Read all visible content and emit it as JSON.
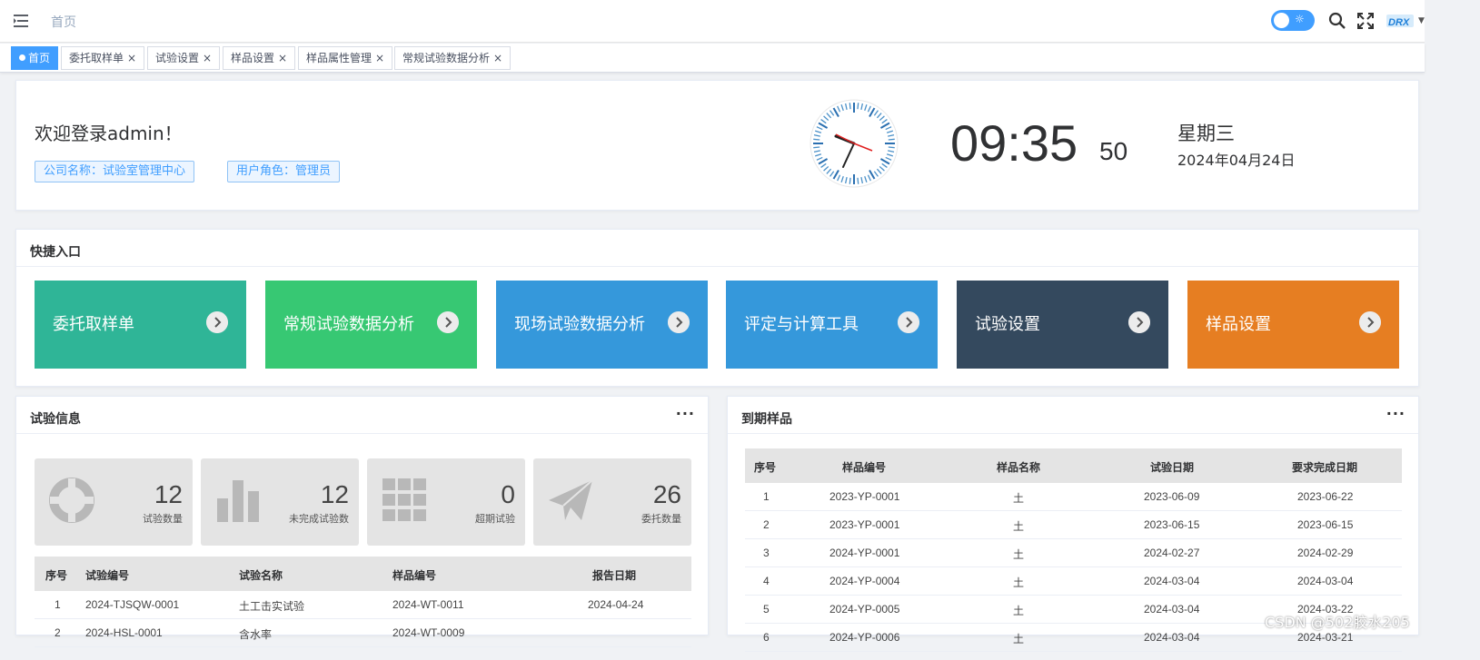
{
  "navbar": {
    "breadcrumb": "首页",
    "icons": [
      "hamburger-icon",
      "theme-toggle-sun-icon",
      "search-icon",
      "fullscreen-icon"
    ],
    "avatar_text": "DRX"
  },
  "tags": [
    {
      "label": "首页",
      "active": true
    },
    {
      "label": "委托取样单",
      "close": "×"
    },
    {
      "label": "试验设置",
      "close": "×"
    },
    {
      "label": "样品设置",
      "close": "×"
    },
    {
      "label": "样品属性管理",
      "close": "×"
    },
    {
      "label": "常规试验数据分析",
      "close": "×"
    }
  ],
  "welcome": {
    "title": "欢迎登录admin！",
    "company": "公司名称：试验室管理中心",
    "role": "用户角色：管理员",
    "time_hm": "09:35",
    "time_sec": "50",
    "weekday": "星期三",
    "date": "2024年04月24日"
  },
  "quick": {
    "title": "快捷入口",
    "tiles": [
      {
        "label": "委托取样单",
        "color": "#2fb597"
      },
      {
        "label": "常规试验数据分析",
        "color": "#37c873"
      },
      {
        "label": "现场试验数据分析",
        "color": "#3598db"
      },
      {
        "label": "评定与计算工具",
        "color": "#3598db"
      },
      {
        "label": "试验设置",
        "color": "#34495e"
      },
      {
        "label": "样品设置",
        "color": "#e67e22"
      }
    ]
  },
  "tests": {
    "title": "试验信息",
    "more": "···",
    "stats": [
      {
        "value": "12",
        "label": "试验数量",
        "icon": "lifebuoy-icon"
      },
      {
        "value": "12",
        "label": "未完成试验数",
        "icon": "bar-chart-icon"
      },
      {
        "value": "0",
        "label": "超期试验",
        "icon": "grid-icon"
      },
      {
        "value": "26",
        "label": "委托数量",
        "icon": "paper-plane-icon"
      }
    ],
    "columns": [
      "序号",
      "试验编号",
      "试验名称",
      "样品编号",
      "报告日期"
    ],
    "rows": [
      [
        "1",
        "2024-TJSQW-0001",
        "土工击实试验",
        "2024-WT-0011",
        "2024-04-24"
      ],
      [
        "2",
        "2024-HSL-0001",
        "含水率",
        "2024-WT-0009",
        ""
      ]
    ]
  },
  "expire": {
    "title": "到期样品",
    "more": "···",
    "columns": [
      "序号",
      "样品编号",
      "样品名称",
      "试验日期",
      "要求完成日期"
    ],
    "rows": [
      [
        "1",
        "2023-YP-0001",
        "土",
        "2023-06-09",
        "2023-06-22"
      ],
      [
        "2",
        "2023-YP-0001",
        "土",
        "2023-06-15",
        "2023-06-15"
      ],
      [
        "3",
        "2024-YP-0001",
        "土",
        "2024-02-27",
        "2024-02-29"
      ],
      [
        "4",
        "2024-YP-0004",
        "土",
        "2024-03-04",
        "2024-03-04"
      ],
      [
        "5",
        "2024-YP-0005",
        "土",
        "2024-03-04",
        "2024-03-22"
      ],
      [
        "6",
        "2024-YP-0006",
        "土",
        "2024-03-04",
        "2024-03-21"
      ]
    ]
  },
  "watermark": "CSDN @502胶水205"
}
